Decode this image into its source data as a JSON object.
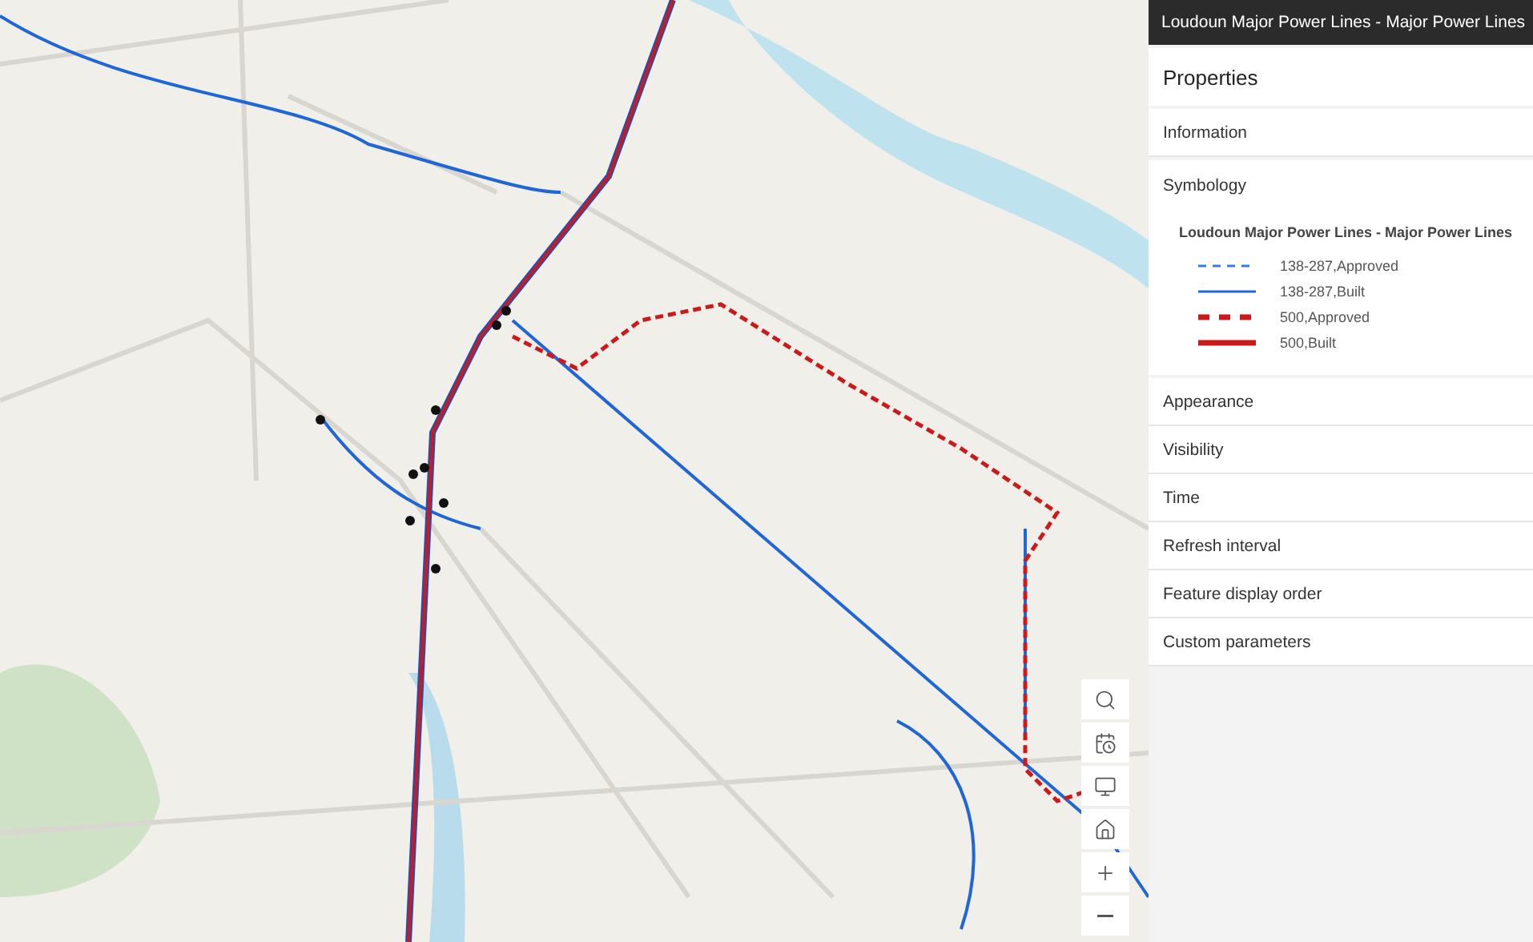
{
  "panel": {
    "title": "Loudoun Major Power Lines - Major Power Lines",
    "heading": "Properties",
    "sections_before": [
      {
        "label": "Information"
      }
    ],
    "symbology": {
      "label": "Symbology",
      "legend_title": "Loudoun Major Power Lines - Major Power Lines",
      "legend": [
        {
          "label": "138-287,Approved",
          "kind": "dash",
          "color": "#3a7be0"
        },
        {
          "label": "138-287,Built",
          "kind": "line",
          "color": "#1f66d6"
        },
        {
          "label": "500,Approved",
          "kind": "heavydash",
          "color": "#cc1a1a"
        },
        {
          "label": "500,Built",
          "kind": "heavyline",
          "color": "#cc1a1a"
        }
      ]
    },
    "sections_after": [
      {
        "label": "Appearance"
      },
      {
        "label": "Visibility"
      },
      {
        "label": "Time"
      },
      {
        "label": "Refresh interval"
      },
      {
        "label": "Feature display order"
      },
      {
        "label": "Custom parameters"
      }
    ]
  },
  "map_tools": [
    {
      "kind": "search"
    },
    {
      "kind": "calendar"
    },
    {
      "kind": "monitor"
    },
    {
      "kind": "home"
    },
    {
      "kind": "zoom-in"
    },
    {
      "kind": "zoom-out"
    }
  ]
}
